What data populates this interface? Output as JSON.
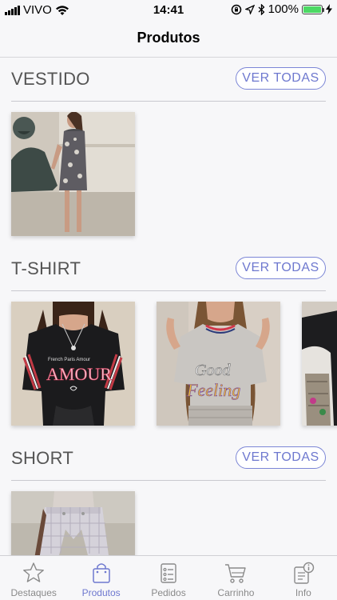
{
  "status_bar": {
    "carrier": "VIVO",
    "time": "14:41",
    "battery": "100%"
  },
  "nav": {
    "title": "Produtos"
  },
  "sections": [
    {
      "title": "VESTIDO",
      "button": "VER TODAS"
    },
    {
      "title": "T-SHIRT",
      "button": "VER TODAS"
    },
    {
      "title": "SHORT",
      "button": "VER TODAS"
    }
  ],
  "tabs": [
    {
      "label": "Destaques",
      "icon": "star-icon"
    },
    {
      "label": "Produtos",
      "icon": "shopping-bag-icon",
      "active": true
    },
    {
      "label": "Pedidos",
      "icon": "clipboard-list-icon"
    },
    {
      "label": "Carrinho",
      "icon": "cart-icon"
    },
    {
      "label": "Info",
      "icon": "info-icon"
    }
  ],
  "colors": {
    "accent": "#6e78cf",
    "battery": "#4cd964"
  }
}
